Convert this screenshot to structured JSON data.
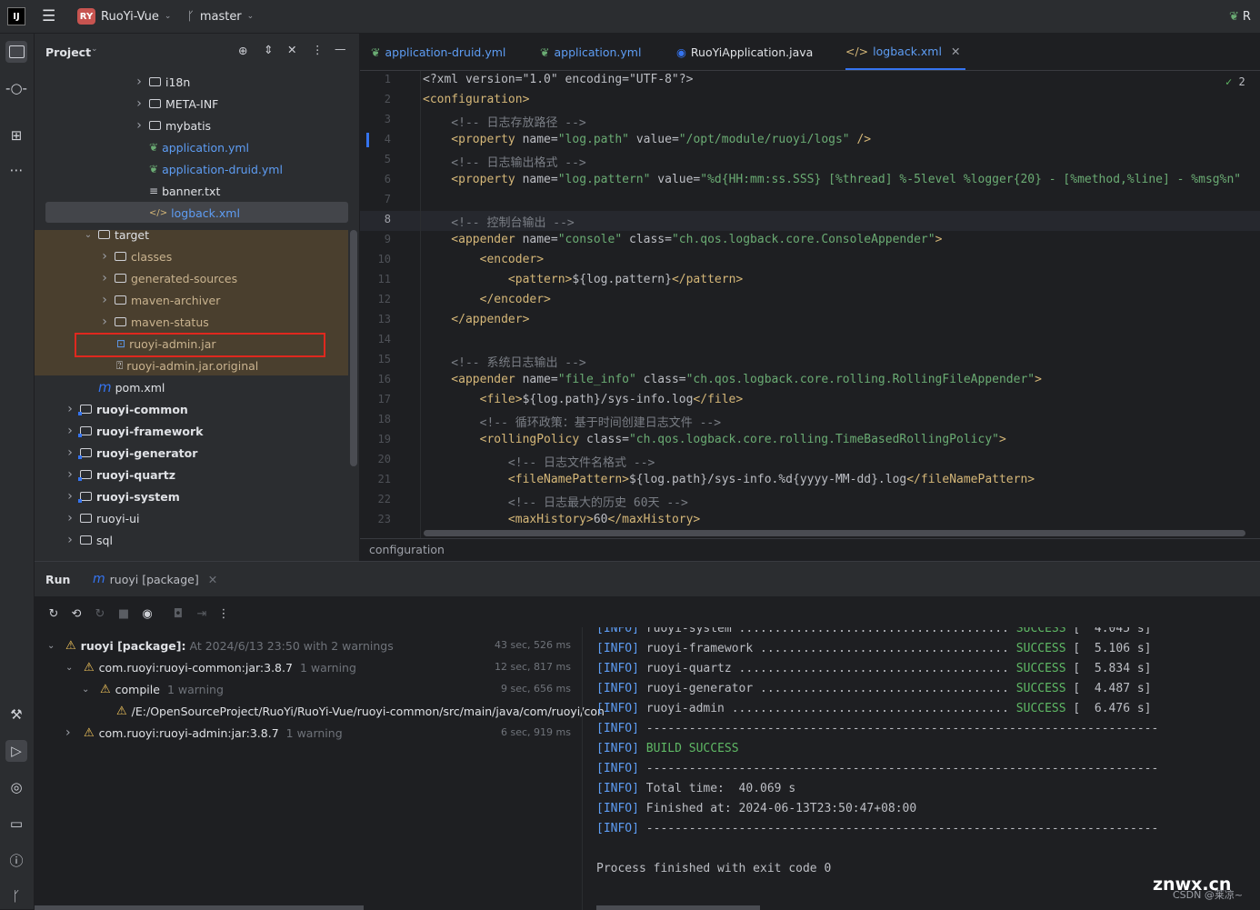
{
  "titlebar": {
    "app_logo": "IJ",
    "project_badge": "RY",
    "project_name": "RuoYi-Vue",
    "branch": "master",
    "right_text": "R"
  },
  "project_panel": {
    "title": "Project",
    "tree": [
      {
        "label": "i18n",
        "kind": "folder",
        "expanded": false
      },
      {
        "label": "META-INF",
        "kind": "folder",
        "expanded": false
      },
      {
        "label": "mybatis",
        "kind": "folder",
        "expanded": false
      },
      {
        "label": "application.yml",
        "kind": "yml"
      },
      {
        "label": "application-druid.yml",
        "kind": "yml"
      },
      {
        "label": "banner.txt",
        "kind": "txt"
      },
      {
        "label": "logback.xml",
        "kind": "xml",
        "selected": true
      },
      {
        "label": "target",
        "kind": "folder",
        "expanded": true
      },
      {
        "label": "classes",
        "kind": "folder",
        "expanded": false
      },
      {
        "label": "generated-sources",
        "kind": "folder",
        "expanded": false
      },
      {
        "label": "maven-archiver",
        "kind": "folder",
        "expanded": false
      },
      {
        "label": "maven-status",
        "kind": "folder",
        "expanded": false
      },
      {
        "label": "ruoyi-admin.jar",
        "kind": "jar",
        "highlighted": true
      },
      {
        "label": "ruoyi-admin.jar.original",
        "kind": "unknown"
      },
      {
        "label": "pom.xml",
        "kind": "maven"
      },
      {
        "label": "ruoyi-common",
        "kind": "module"
      },
      {
        "label": "ruoyi-framework",
        "kind": "module"
      },
      {
        "label": "ruoyi-generator",
        "kind": "module"
      },
      {
        "label": "ruoyi-quartz",
        "kind": "module"
      },
      {
        "label": "ruoyi-system",
        "kind": "module"
      },
      {
        "label": "ruoyi-ui",
        "kind": "folder"
      },
      {
        "label": "sql",
        "kind": "folder"
      }
    ]
  },
  "editor": {
    "tabs": [
      {
        "label": "application-druid.yml",
        "icon": "yml-icon"
      },
      {
        "label": "application.yml",
        "icon": "yml-icon"
      },
      {
        "label": "RuoYiApplication.java",
        "icon": "java-class-icon"
      },
      {
        "label": "logback.xml",
        "icon": "xml-icon",
        "active": true
      }
    ],
    "inspection_count": "2",
    "lines": [
      {
        "n": "1",
        "segs": [
          [
            "pi",
            "<?xml version=\"1.0\" encoding=\"UTF-8\"?>"
          ]
        ]
      },
      {
        "n": "2",
        "segs": [
          [
            "tag",
            "<configuration>"
          ]
        ]
      },
      {
        "n": "3",
        "segs": [
          [
            "com",
            "    <!-- 日志存放路径 -->"
          ]
        ]
      },
      {
        "n": "4",
        "segs": [
          [
            "tag",
            "    <property"
          ],
          [
            "attr",
            " name="
          ],
          [
            "val",
            "\"log.path\""
          ],
          [
            "attr",
            " value="
          ],
          [
            "val",
            "\"/opt/module/ruoyi/logs\""
          ],
          [
            "tag",
            " />"
          ]
        ]
      },
      {
        "n": "5",
        "segs": [
          [
            "com",
            "    <!-- 日志输出格式 -->"
          ]
        ]
      },
      {
        "n": "6",
        "segs": [
          [
            "tag",
            "    <property"
          ],
          [
            "attr",
            " name="
          ],
          [
            "val",
            "\"log.pattern\""
          ],
          [
            "attr",
            " value="
          ],
          [
            "val",
            "\"%d{HH:mm:ss.SSS} [%thread] %-5level %logger{20} - [%method,%line] - %msg%n\""
          ]
        ]
      },
      {
        "n": "7",
        "segs": []
      },
      {
        "n": "8",
        "segs": [
          [
            "com",
            "    <!-- 控制台输出 -->"
          ]
        ]
      },
      {
        "n": "9",
        "segs": [
          [
            "tag",
            "    <appender"
          ],
          [
            "attr",
            " name="
          ],
          [
            "val",
            "\"console\""
          ],
          [
            "attr",
            " class="
          ],
          [
            "val",
            "\"ch.qos.logback.core.ConsoleAppender\""
          ],
          [
            "tag",
            ">"
          ]
        ]
      },
      {
        "n": "10",
        "segs": [
          [
            "tag",
            "        <encoder>"
          ]
        ]
      },
      {
        "n": "11",
        "segs": [
          [
            "tag",
            "            <pattern>"
          ],
          [
            "attr",
            "${log.pattern}"
          ],
          [
            "tag",
            "</pattern>"
          ]
        ]
      },
      {
        "n": "12",
        "segs": [
          [
            "tag",
            "        </encoder>"
          ]
        ]
      },
      {
        "n": "13",
        "segs": [
          [
            "tag",
            "    </appender>"
          ]
        ]
      },
      {
        "n": "14",
        "segs": []
      },
      {
        "n": "15",
        "segs": [
          [
            "com",
            "    <!-- 系统日志输出 -->"
          ]
        ]
      },
      {
        "n": "16",
        "segs": [
          [
            "tag",
            "    <appender"
          ],
          [
            "attr",
            " name="
          ],
          [
            "val",
            "\"file_info\""
          ],
          [
            "attr",
            " class="
          ],
          [
            "val",
            "\"ch.qos.logback.core.rolling.RollingFileAppender\""
          ],
          [
            "tag",
            ">"
          ]
        ]
      },
      {
        "n": "17",
        "segs": [
          [
            "tag",
            "        <file>"
          ],
          [
            "attr",
            "${log.path}/sys-info.log"
          ],
          [
            "tag",
            "</file>"
          ]
        ]
      },
      {
        "n": "18",
        "segs": [
          [
            "com",
            "        <!-- 循环政策：基于时间创建日志文件 -->"
          ]
        ]
      },
      {
        "n": "19",
        "segs": [
          [
            "tag",
            "        <rollingPolicy"
          ],
          [
            "attr",
            " class="
          ],
          [
            "val",
            "\"ch.qos.logback.core.rolling.TimeBasedRollingPolicy\""
          ],
          [
            "tag",
            ">"
          ]
        ]
      },
      {
        "n": "20",
        "segs": [
          [
            "com",
            "            <!-- 日志文件名格式 -->"
          ]
        ]
      },
      {
        "n": "21",
        "segs": [
          [
            "tag",
            "            <fileNamePattern>"
          ],
          [
            "attr",
            "${log.path}/sys-info.%d{yyyy-MM-dd}.log"
          ],
          [
            "tag",
            "</fileNamePattern>"
          ]
        ]
      },
      {
        "n": "22",
        "segs": [
          [
            "com",
            "            <!-- 日志最大的历史 60天 -->"
          ]
        ]
      },
      {
        "n": "23",
        "segs": [
          [
            "tag",
            "            <maxHistory>"
          ],
          [
            "attr",
            "60"
          ],
          [
            "tag",
            "</maxHistory>"
          ]
        ]
      }
    ],
    "breadcrumb": "configuration"
  },
  "run_panel": {
    "title": "Run",
    "tab_label": "ruoyi [package]",
    "tree": [
      {
        "label": "ruoyi [package]:",
        "suffix": "At 2024/6/13 23:50 with 2 warnings",
        "time": "43 sec, 526 ms",
        "bold": true,
        "chev": "down"
      },
      {
        "label": "com.ruoyi:ruoyi-common:jar:3.8.7",
        "suffix": "1 warning",
        "time": "12 sec, 817 ms",
        "chev": "down"
      },
      {
        "label": "compile",
        "suffix": "1 warning",
        "time": "9 sec, 656 ms",
        "chev": "down"
      },
      {
        "label": "/E:/OpenSourceProject/RuoYi/RuoYi-Vue/ruoyi-common/src/main/java/com/ruoyi/con",
        "suffix": "",
        "time": "",
        "chev": ""
      },
      {
        "label": "com.ruoyi:ruoyi-admin:jar:3.8.7",
        "suffix": "1 warning",
        "time": "6 sec, 919 ms",
        "chev": "right"
      }
    ],
    "console": [
      {
        "tag": "[INFO]",
        "text": " ruoyi-system ...................................... ",
        "status": "SUCCESS",
        "tail": " [  4.045 s]"
      },
      {
        "tag": "[INFO]",
        "text": " ruoyi-framework ................................... ",
        "status": "SUCCESS",
        "tail": " [  5.106 s]"
      },
      {
        "tag": "[INFO]",
        "text": " ruoyi-quartz ...................................... ",
        "status": "SUCCESS",
        "tail": " [  5.834 s]"
      },
      {
        "tag": "[INFO]",
        "text": " ruoyi-generator ................................... ",
        "status": "SUCCESS",
        "tail": " [  4.487 s]"
      },
      {
        "tag": "[INFO]",
        "text": " ruoyi-admin ....................................... ",
        "status": "SUCCESS",
        "tail": " [  6.476 s]"
      },
      {
        "tag": "[INFO]",
        "text": " ------------------------------------------------------------------------",
        "status": "",
        "tail": ""
      },
      {
        "tag": "[INFO]",
        "text": " ",
        "status": "BUILD SUCCESS",
        "tail": ""
      },
      {
        "tag": "[INFO]",
        "text": " ------------------------------------------------------------------------",
        "status": "",
        "tail": ""
      },
      {
        "tag": "[INFO]",
        "text": " Total time:  40.069 s",
        "status": "",
        "tail": ""
      },
      {
        "tag": "[INFO]",
        "text": " Finished at: 2024-06-13T23:50:47+08:00",
        "status": "",
        "tail": ""
      },
      {
        "tag": "[INFO]",
        "text": " ------------------------------------------------------------------------",
        "status": "",
        "tail": ""
      },
      {
        "tag": "",
        "text": "",
        "status": "",
        "tail": ""
      },
      {
        "tag": "",
        "text": "Process finished with exit code 0",
        "status": "",
        "tail": ""
      }
    ]
  },
  "watermark": "znwx.cn",
  "watermark_small": "CSDN @莱凉~",
  "colors": {
    "accent": "#3574f0",
    "highlight_box": "#e0281e",
    "target_bg": "#4a3f2e"
  }
}
